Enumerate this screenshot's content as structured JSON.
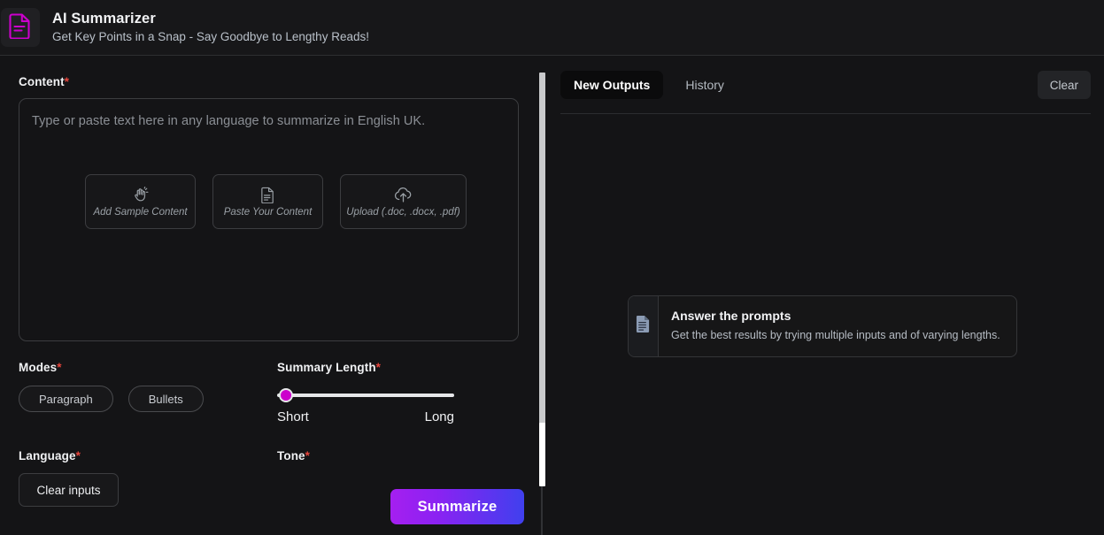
{
  "header": {
    "icon": "document-lines-icon",
    "title": "AI Summarizer",
    "subtitle": "Get Key Points in a Snap - Say Goodbye to Lengthy Reads!"
  },
  "left": {
    "content": {
      "label": "Content",
      "required_marker": "*",
      "placeholder": "Type or paste text here in any language to summarize in English UK.",
      "quick_actions": [
        {
          "icon": "waving-hand-icon",
          "label": "Add Sample Content"
        },
        {
          "icon": "document-icon",
          "label": "Paste Your Content"
        },
        {
          "icon": "cloud-upload-icon",
          "label": "Upload (.doc, .docx, .pdf)"
        }
      ]
    },
    "modes": {
      "label": "Modes",
      "required_marker": "*",
      "options": [
        {
          "label": "Paragraph"
        },
        {
          "label": "Bullets"
        }
      ]
    },
    "summary_length": {
      "label": "Summary Length",
      "required_marker": "*",
      "value": 0,
      "min_label": "Short",
      "max_label": "Long"
    },
    "language": {
      "label": "Language",
      "required_marker": "*"
    },
    "tone": {
      "label": "Tone",
      "required_marker": "*"
    },
    "clear_inputs_label": "Clear inputs",
    "summarize_label": "Summarize"
  },
  "right": {
    "tabs": [
      {
        "label": "New Outputs",
        "active": true
      },
      {
        "label": "History",
        "active": false
      }
    ],
    "clear_label": "Clear",
    "hint": {
      "icon": "document-lines-icon",
      "title": "Answer the prompts",
      "subtitle": "Get the best results by trying multiple inputs and of varying lengths."
    }
  },
  "colors": {
    "accent_magenta": "#cc00cc",
    "required_red": "#e8453c",
    "gradient_start": "#a51ff0",
    "gradient_end": "#4040ee",
    "background": "#141416"
  }
}
